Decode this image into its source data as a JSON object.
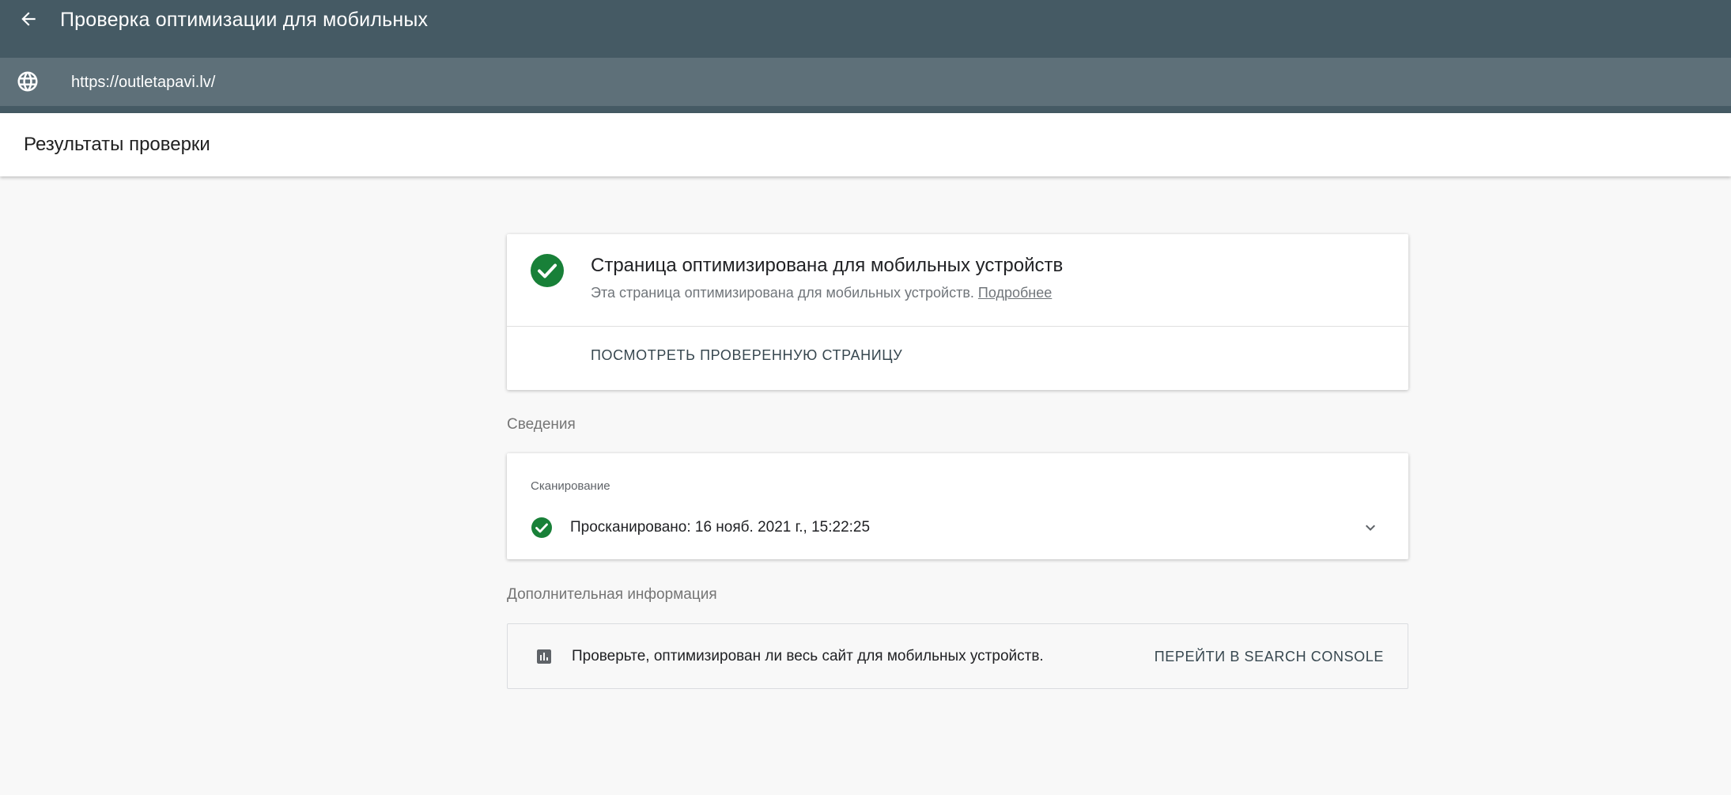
{
  "app_bar": {
    "title": "Проверка оптимизации для мобильных"
  },
  "url_bar": {
    "url": "https://outletapavi.lv/"
  },
  "results": {
    "title": "Результаты проверки"
  },
  "status_card": {
    "title": "Страница оптимизирована для мобильных устройств",
    "description": "Эта страница оптимизирована для мобильных устройств.",
    "learn_more": "Подробнее",
    "view_page_label": "ПОСМОТРЕТЬ ПРОВЕРЕННУЮ СТРАНИЦУ"
  },
  "details": {
    "section_label": "Сведения",
    "scan_subtitle": "Сканирование",
    "scan_text": "Просканировано: 16 нояб. 2021 г., 15:22:25"
  },
  "extra": {
    "section_label": "Дополнительная информация",
    "text": "Проверьте, оптимизирован ли весь сайт для мобильных устройств.",
    "button_label": "ПЕРЕЙТИ В SEARCH CONSOLE"
  },
  "colors": {
    "app_bar": "#455a64",
    "url_bar": "#5e7079",
    "success_green": "#188038"
  },
  "icons": {
    "back": "arrow-back-icon",
    "globe": "globe-icon",
    "status": "check-circle-icon",
    "scan": "check-circle-icon",
    "expand": "chevron-down-icon",
    "extra": "bar-chart-icon"
  }
}
